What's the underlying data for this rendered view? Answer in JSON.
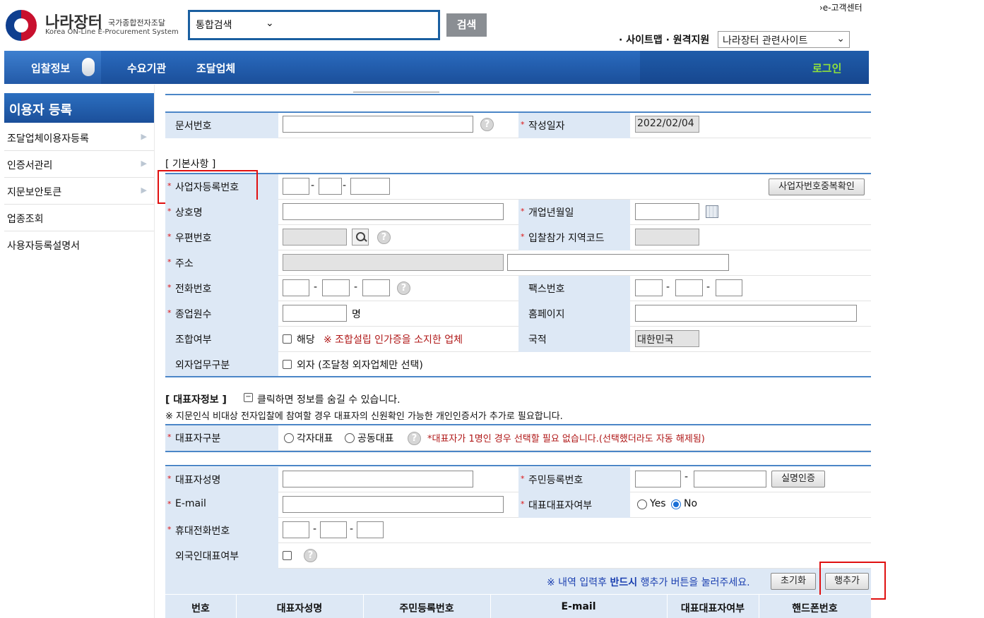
{
  "header": {
    "logo_title": "나라장터",
    "logo_sub": "국가종합전자조달",
    "logo_en": "Korea ON-Line E-Procurement System",
    "search_scope": "통합검색",
    "search_button": "검색",
    "ecenter": "›e-고객센터",
    "links": "· 사이트맵 · 원격지원",
    "site_select": "나라장터 관련사이트"
  },
  "nav": {
    "items": [
      "입찰정보",
      "수요기관",
      "조달업체"
    ],
    "login": "로그인"
  },
  "sidebar": {
    "title": "이용자 등록",
    "items": [
      {
        "label": "조달업체이용자등록",
        "arrow": true
      },
      {
        "label": "인증서관리",
        "arrow": true
      },
      {
        "label": "지문보안토큰",
        "arrow": true
      },
      {
        "label": "업종조회",
        "arrow": false
      },
      {
        "label": "사용자등록설명서",
        "arrow": false
      }
    ]
  },
  "form": {
    "doc_no_label": "문서번호",
    "created_label": "작성일자",
    "created_value": "2022/02/04",
    "basic_section": "[ 기본사항 ]",
    "bizno_label": "사업자등록번호",
    "bizno_dup_btn": "사업자번호중복확인",
    "company_label": "상호명",
    "open_date_label": "개업년월일",
    "zip_label": "우편번호",
    "region_label": "입찰참가 지역코드",
    "addr_label": "주소",
    "phone_label": "전화번호",
    "fax_label": "팩스번호",
    "employees_label": "종업원수",
    "employees_unit": "명",
    "homepage_label": "홈페이지",
    "union_label": "조합여부",
    "union_check": "해당",
    "union_note": "※ 조합설립 인가증을 소지한 업체",
    "country_label": "국적",
    "country_value": "대한민국",
    "foreign_label": "외자업무구분",
    "foreign_check": "외자 (조달청 외자업체만 선택)"
  },
  "rep": {
    "section": "[ 대표자정보 ]",
    "toggle_text": "클릭하면 정보를 숨길 수 있습니다.",
    "notice": "※ 지문인식 비대상 전자입찰에 참여할 경우 대표자의 신원확인 가능한 개인인증서가 추가로 필요합니다.",
    "type_label": "대표자구분",
    "type_opt1": "각자대표",
    "type_opt2": "공동대표",
    "type_note": "*대표자가 1명인 경우 선택할 필요 없습니다.(선택했더라도 자동 해제됨)",
    "name_label": "대표자성명",
    "rrn_label": "주민등록번호",
    "verify_btn": "실명인증",
    "email_label": "E-mail",
    "main_rep_label": "대표대표자여부",
    "main_rep_yes": "Yes",
    "main_rep_no": "No",
    "mobile_label": "휴대전화번호",
    "foreigner_label": "외국인대표여부",
    "add_notice_pre": "※ 내역 입력후 ",
    "add_notice_bold": "반드시",
    "add_notice_post": " 행추가 버튼을 눌러주세요.",
    "reset_btn": "초기화",
    "add_btn": "행추가",
    "table_headers": [
      "번호",
      "대표자성명",
      "주민등록번호",
      "E-mail",
      "대표대표자여부",
      "핸드폰번호"
    ]
  },
  "colors": {
    "nav_blue": "#1b4f9a",
    "label_bg": "#dde8f5",
    "required": "#d11111",
    "highlight": "#e01010",
    "login_green": "#8fe13c"
  }
}
